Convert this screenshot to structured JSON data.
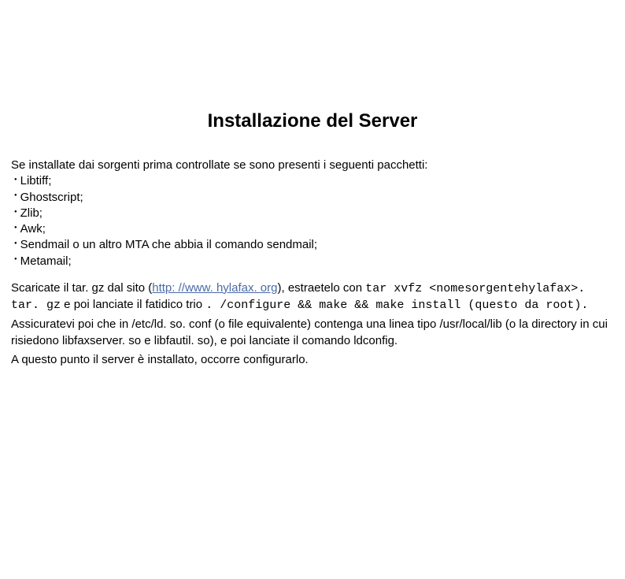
{
  "title": "Installazione del Server",
  "intro": "Se installate dai sorgenti prima controllate se sono presenti i seguenti pacchetti:",
  "packages": [
    "Libtiff;",
    "Ghostscript;",
    "Zlib;",
    "Awk;",
    "Sendmail o un altro MTA che abbia il comando sendmail;",
    "Metamail;"
  ],
  "download": {
    "pre_link": "Scaricate il tar. gz dal sito (",
    "link_text": "http: //www. hylafax. org",
    "link_suffix": "), estraetelo con",
    "cmd1": "tar xvfz <nomesorgentehylafax>. tar. gz",
    "mid": " e poi lanciate il fatidico trio ",
    "cmd2": ". /configure && make && make install (questo da root)."
  },
  "ldconf": "Assicuratevi poi che in /etc/ld. so. conf (o file equivalente) contenga una linea tipo /usr/local/lib (o la directory in cui risiedono libfaxserver. so e libfautil. so), e poi lanciate il comando ldconfig.",
  "final": "A questo punto il server è installato, occorre configurarlo."
}
